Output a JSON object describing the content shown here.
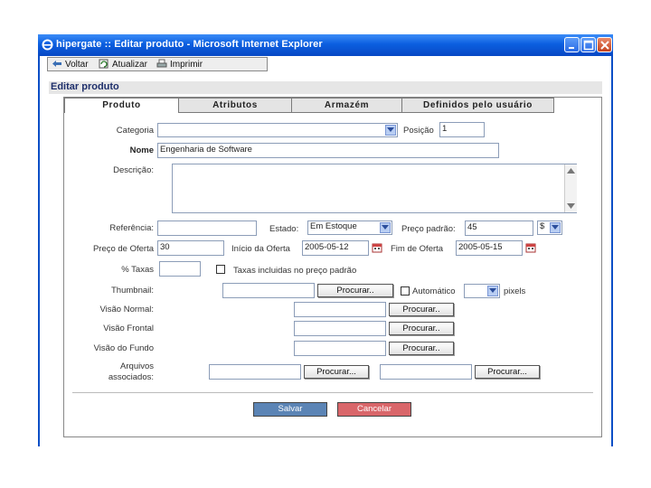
{
  "window": {
    "title": "hipergate :: Editar produto - Microsoft Internet Explorer"
  },
  "toolbar": {
    "back_label": "Voltar",
    "refresh_label": "Atualizar",
    "print_label": "Imprimir"
  },
  "page": {
    "title": "Editar produto"
  },
  "tabs": [
    {
      "label": "Produto"
    },
    {
      "label": "Atributos"
    },
    {
      "label": "Armazém"
    },
    {
      "label": "Definidos pelo usuário"
    }
  ],
  "form": {
    "categoria_label": "Categoria",
    "categoria_value": "",
    "posicao_label": "Posição",
    "posicao_value": "1",
    "nome_label": "Nome",
    "nome_value": "Engenharia de Software",
    "descricao_label": "Descrição:",
    "descricao_value": "",
    "referencia_label": "Referência:",
    "referencia_value": "",
    "estado_label": "Estado:",
    "estado_value": "Em Estoque",
    "preco_padrao_label": "Preço padrão:",
    "preco_padrao_value": "45",
    "moeda_value": "$",
    "preco_oferta_label": "Preço de Oferta",
    "preco_oferta_value": "30",
    "inicio_oferta_label": "Início da Oferta",
    "inicio_oferta_value": "2005-05-12",
    "fim_oferta_label": "Fim de Oferta",
    "fim_oferta_value": "2005-05-15",
    "taxas_label": "% Taxas",
    "taxas_value": "",
    "taxas_incluidas_label": "Taxas incluidas no preço padrão",
    "thumbnail_label": "Thumbnail:",
    "automatico_label": "Automático",
    "pixels_label": "pixels",
    "visao_normal_label": "Visão Normal:",
    "visao_frontal_label": "Visão Frontal",
    "visao_fundo_label": "Visão do Fundo",
    "arquivos_label_1": "Arquivos",
    "arquivos_label_2": "associados:",
    "procurar_label": "Procurar..",
    "procurar_label_b": "Procurar..."
  },
  "actions": {
    "save_label": "Salvar",
    "cancel_label": "Cancelar"
  },
  "colors": {
    "titlebar": "#0b5fe0",
    "save_button": "#5b84b5",
    "cancel_button": "#d9666a"
  }
}
